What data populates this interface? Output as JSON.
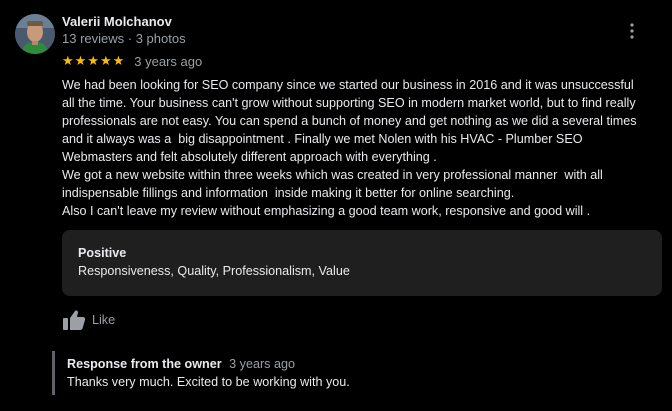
{
  "reviewer": {
    "name": "Valerii Molchanov",
    "meta": "13 reviews · 3 photos",
    "avatar_icon": "reviewer-avatar-photo"
  },
  "rating": {
    "stars": 5,
    "max": 5,
    "star_glyph": "★",
    "star_color": "#fbbc04",
    "date": "3 years ago"
  },
  "review_text": "We had been looking for SEO company since we started our business in 2016 and it was unsuccessful\nall the time. Your business can't grow without supporting SEO in modern market world, but to find really\nprofessionals are not easy. You can spend a bunch of money and get nothing as we did a several times\nand it always was a  big disappointment . Finally we met Nolen with his HVAC - Plumber SEO\nWebmasters and felt absolutely different approach with everything .\nWe got a new website within three weeks which was created in very professional manner  with all\nindispensable fillings and information  inside making it better for online searching.\nAlso I can't leave my review without emphasizing a good team work, responsive and good will .",
  "attributes": {
    "title": "Positive",
    "values": "Responsiveness, Quality, Professionalism, Value"
  },
  "actions": {
    "like_label": "Like",
    "like_icon": "thumbs-up-icon",
    "menu_icon": "more-vert-icon"
  },
  "owner_response": {
    "title": "Response from the owner",
    "date": "3 years ago",
    "text": "Thanks very much. Excited to be working with you."
  },
  "colors": {
    "background": "#000000",
    "text": "#e8eaed",
    "secondary_text": "#9aa0a6",
    "card": "#1f1f1f",
    "response_border": "#5f6368"
  }
}
